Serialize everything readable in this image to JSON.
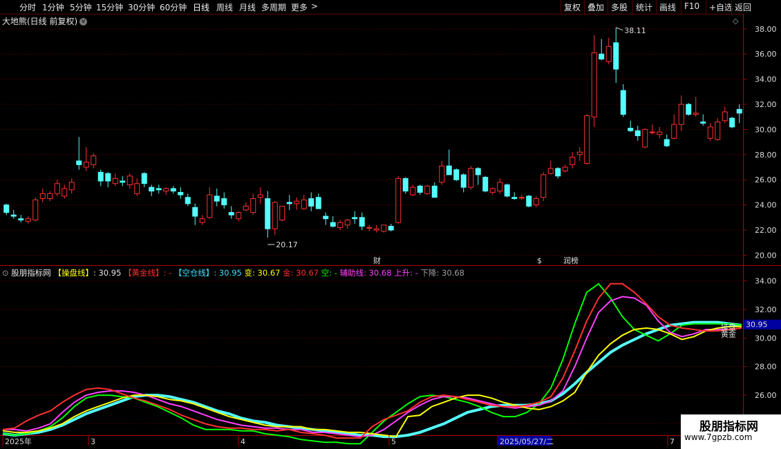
{
  "toolbar": {
    "periods": [
      "分时",
      "1分钟",
      "5分钟",
      "15分钟",
      "30分钟",
      "60分钟",
      "日线",
      "周线",
      "月线",
      "多周期",
      "更多"
    ],
    "active_period": "日线",
    "more_arrow": ">",
    "right_buttons": [
      "复权",
      "叠加",
      "多股",
      "统计",
      "画线",
      "F10",
      "+自选",
      "返回"
    ]
  },
  "main_chart": {
    "title": "大地熊(日线 前复权)",
    "chevron_glyph": "v",
    "diamond_glyph": "◇",
    "gear_glyph": "⚙"
  },
  "indicator": {
    "name": "股朋指标网",
    "segments": [
      {
        "text": "【操盘线】",
        "color": "#ffff00"
      },
      {
        "text": ": 30.95 ",
        "color": "#e6e6e6"
      },
      {
        "text": "【黄金线】",
        "color": "#ff3030"
      },
      {
        "text": ": - ",
        "color": "#ff3030"
      },
      {
        "text": "【空仓线】",
        "color": "#40e0ff"
      },
      {
        "text": ": 30.95 ",
        "color": "#40e0ff"
      },
      {
        "text": "变: 30.67 ",
        "color": "#ffff00"
      },
      {
        "text": "金: 30.67 ",
        "color": "#ff3030"
      },
      {
        "text": "空: - ",
        "color": "#00ff00"
      },
      {
        "text": "辅助线: 30.68 ",
        "color": "#ff40ff"
      },
      {
        "text": "上升: - ",
        "color": "#ff40ff"
      },
      {
        "text": "下降: 30.68",
        "color": "#a0a0a0"
      }
    ],
    "value_box": "30.95",
    "side_labels": [
      "操盘",
      "黄金"
    ]
  },
  "watermark": {
    "line1": "股朋指标网",
    "line2": "www.7gpzb.com"
  },
  "colors": {
    "up": "#ff3232",
    "down": "#54ffff",
    "grid": "#7a0000",
    "axis_border": "#b40000"
  },
  "chart_data": [
    {
      "type": "candlestick",
      "title": "大地熊(日线 前复权)",
      "ylim": [
        19.2,
        39.2
      ],
      "yticks": [
        20,
        22,
        24,
        26,
        28,
        30,
        32,
        34,
        36,
        38
      ],
      "ytick_labels": [
        "20.00",
        "22.00",
        "24.00",
        "26.00",
        "28.00",
        "30.00",
        "32.00",
        "34.00",
        "36.00",
        "38.00"
      ],
      "annotations": {
        "high": "38.11",
        "low": "20.17"
      },
      "markers": [
        "财",
        "$",
        "润榜"
      ],
      "ohlc": [
        [
          24.0,
          24.1,
          23.2,
          23.4
        ],
        [
          23.2,
          23.6,
          22.9,
          23.1
        ],
        [
          22.9,
          23.2,
          22.6,
          22.8
        ],
        [
          22.7,
          23.1,
          22.5,
          22.9
        ],
        [
          22.8,
          24.6,
          22.7,
          24.4
        ],
        [
          24.5,
          25.3,
          24.2,
          24.9
        ],
        [
          24.5,
          25.1,
          24.3,
          24.9
        ],
        [
          24.9,
          26.0,
          24.7,
          25.7
        ],
        [
          24.7,
          25.6,
          24.5,
          25.3
        ],
        [
          25.2,
          26.1,
          24.9,
          25.8
        ],
        [
          27.5,
          29.4,
          26.8,
          27.2
        ],
        [
          27.0,
          28.6,
          26.7,
          27.4
        ],
        [
          27.2,
          28.1,
          26.9,
          27.9
        ],
        [
          26.6,
          26.8,
          25.5,
          25.9
        ],
        [
          26.5,
          26.6,
          25.4,
          25.9
        ],
        [
          25.7,
          26.5,
          25.5,
          26.1
        ],
        [
          25.9,
          26.3,
          25.5,
          25.8
        ],
        [
          25.6,
          26.5,
          25.3,
          26.3
        ],
        [
          24.9,
          26.1,
          24.7,
          25.7
        ],
        [
          26.5,
          26.6,
          25.4,
          25.7
        ],
        [
          25.4,
          25.6,
          24.7,
          25.1
        ],
        [
          25.3,
          25.6,
          24.9,
          25.2
        ],
        [
          25.1,
          25.4,
          24.8,
          25.3
        ],
        [
          25.3,
          25.5,
          24.9,
          25.1
        ],
        [
          25.0,
          25.4,
          24.5,
          24.8
        ],
        [
          24.6,
          24.9,
          23.9,
          24.1
        ],
        [
          23.8,
          24.1,
          22.4,
          23.1
        ],
        [
          22.6,
          23.2,
          22.4,
          22.9
        ],
        [
          23.0,
          25.4,
          22.9,
          24.8
        ],
        [
          24.7,
          25.3,
          23.9,
          24.3
        ],
        [
          24.5,
          25.0,
          23.7,
          24.0
        ],
        [
          23.4,
          23.9,
          22.9,
          23.2
        ],
        [
          22.9,
          23.5,
          22.7,
          23.4
        ],
        [
          23.6,
          24.2,
          23.5,
          23.9
        ],
        [
          23.4,
          24.9,
          23.2,
          24.5
        ],
        [
          24.6,
          25.4,
          24.1,
          24.8
        ],
        [
          24.5,
          25.1,
          21.4,
          22.1
        ],
        [
          22.1,
          24.3,
          21.6,
          24.2
        ],
        [
          22.8,
          23.8,
          22.7,
          23.9
        ],
        [
          24.2,
          24.8,
          23.6,
          24.1
        ],
        [
          24.1,
          24.6,
          23.6,
          24.3
        ],
        [
          23.7,
          24.8,
          23.6,
          24.4
        ],
        [
          24.5,
          25.0,
          23.5,
          23.9
        ],
        [
          24.6,
          24.9,
          23.7,
          23.7
        ],
        [
          23.1,
          23.4,
          22.4,
          22.9
        ],
        [
          22.6,
          23.1,
          22.2,
          22.3
        ],
        [
          22.2,
          22.8,
          22.0,
          22.6
        ],
        [
          22.4,
          22.9,
          22.1,
          22.8
        ],
        [
          23.0,
          23.5,
          22.5,
          22.9
        ],
        [
          23.0,
          23.4,
          22.0,
          22.3
        ],
        [
          22.2,
          22.4,
          21.9,
          22.2
        ],
        [
          22.0,
          22.4,
          21.8,
          22.1
        ],
        [
          21.9,
          22.4,
          21.8,
          22.4
        ],
        [
          22.3,
          22.5,
          21.9,
          22.0
        ],
        [
          22.6,
          26.3,
          22.5,
          26.1
        ],
        [
          26.1,
          26.2,
          24.9,
          25.1
        ],
        [
          24.8,
          25.6,
          24.7,
          25.4
        ],
        [
          25.5,
          25.6,
          24.8,
          25.0
        ],
        [
          24.9,
          25.6,
          24.8,
          25.5
        ],
        [
          25.5,
          25.8,
          24.6,
          24.6
        ],
        [
          25.8,
          27.5,
          25.6,
          27.1
        ],
        [
          27.1,
          28.4,
          26.6,
          26.4
        ],
        [
          26.8,
          26.9,
          25.9,
          26.0
        ],
        [
          26.4,
          26.5,
          25.0,
          25.4
        ],
        [
          25.4,
          27.1,
          25.2,
          26.9
        ],
        [
          26.9,
          27.0,
          25.6,
          26.4
        ],
        [
          26.2,
          26.3,
          25.0,
          25.1
        ],
        [
          25.0,
          25.4,
          24.8,
          25.3
        ],
        [
          25.1,
          26.1,
          24.9,
          25.8
        ],
        [
          25.6,
          25.7,
          24.6,
          24.7
        ],
        [
          24.6,
          25.0,
          24.4,
          24.5
        ],
        [
          24.6,
          24.8,
          24.4,
          24.6
        ],
        [
          24.7,
          24.8,
          23.8,
          23.9
        ],
        [
          24.0,
          24.7,
          23.8,
          24.5
        ],
        [
          24.6,
          26.6,
          24.3,
          26.4
        ],
        [
          26.5,
          27.5,
          26.4,
          26.9
        ],
        [
          26.9,
          27.0,
          26.1,
          26.3
        ],
        [
          26.7,
          27.2,
          26.6,
          27.0
        ],
        [
          27.2,
          28.2,
          26.9,
          27.8
        ],
        [
          28.0,
          28.6,
          27.5,
          28.2
        ],
        [
          27.3,
          31.2,
          27.2,
          31.1
        ],
        [
          31.0,
          37.5,
          30.2,
          36.1
        ],
        [
          36.0,
          37.2,
          35.5,
          35.6
        ],
        [
          35.4,
          37.3,
          35.2,
          36.6
        ],
        [
          36.9,
          38.11,
          33.7,
          34.8
        ],
        [
          33.1,
          33.6,
          31.0,
          31.2
        ],
        [
          30.1,
          30.7,
          29.8,
          29.9
        ],
        [
          29.9,
          30.3,
          29.1,
          29.5
        ],
        [
          28.6,
          30.1,
          28.5,
          30.0
        ],
        [
          29.8,
          30.4,
          29.6,
          29.8
        ],
        [
          29.6,
          30.2,
          29.3,
          29.8
        ],
        [
          29.2,
          29.6,
          28.6,
          28.7
        ],
        [
          29.3,
          31.2,
          29.2,
          30.4
        ],
        [
          30.4,
          32.7,
          29.9,
          32.0
        ],
        [
          32.0,
          32.1,
          31.1,
          31.2
        ],
        [
          31.2,
          32.6,
          31.0,
          31.3
        ],
        [
          30.6,
          31.2,
          30.3,
          30.5
        ],
        [
          29.3,
          30.5,
          29.1,
          30.2
        ],
        [
          29.2,
          30.9,
          29.1,
          30.6
        ],
        [
          30.7,
          31.8,
          30.5,
          31.4
        ],
        [
          30.9,
          31.0,
          30.1,
          30.2
        ],
        [
          31.6,
          32.0,
          30.5,
          31.3
        ]
      ]
    },
    {
      "type": "line",
      "title": "股朋指标网",
      "ylim": [
        23.2,
        35.0
      ],
      "yticks": [
        24,
        26,
        28,
        30,
        32,
        34
      ],
      "ytick_labels": [
        "24.00",
        "26.00",
        "28.00",
        "30.00",
        "32.00",
        "34.00"
      ],
      "xtick_labels": [
        "2025年",
        "3",
        "4",
        "5",
        "2025/05/27/二",
        "7"
      ],
      "series": [
        {
          "name": "操盘线",
          "color": "#ffff00",
          "values": [
            23.5,
            23.4,
            23.4,
            23.5,
            23.7,
            24.0,
            24.5,
            24.9,
            25.2,
            25.5,
            25.8,
            26.0,
            26.0,
            25.9,
            25.7,
            25.6,
            25.4,
            25.1,
            24.8,
            24.5,
            24.3,
            24.1,
            23.9,
            23.8,
            23.8,
            23.8,
            23.6,
            23.6,
            23.5,
            23.4,
            23.4,
            23.3,
            23.2,
            23.1,
            24.5,
            24.6,
            25.2,
            25.5,
            25.8,
            26.0,
            26.0,
            25.8,
            25.5,
            25.3,
            25.1,
            25.0,
            25.2,
            25.6,
            26.2,
            27.6,
            28.8,
            29.6,
            30.2,
            30.6,
            30.7,
            30.6,
            30.3,
            29.9,
            30.1,
            30.5,
            30.7,
            30.8,
            30.8
          ]
        },
        {
          "name": "黄金线",
          "color": "#ff3030",
          "values": [
            23.6,
            23.7,
            24.2,
            24.6,
            24.9,
            25.5,
            26.0,
            26.4,
            26.5,
            26.4,
            26.1,
            25.8,
            25.6,
            25.3,
            25.0,
            24.6,
            24.3,
            24.0,
            23.8,
            23.7,
            23.7,
            23.6,
            23.6,
            23.5,
            23.6,
            23.4,
            23.3,
            23.2,
            23.0,
            23.0,
            23.0,
            23.8,
            24.3,
            24.6,
            24.9,
            25.5,
            25.9,
            26.0,
            25.9,
            25.7,
            25.5,
            25.3,
            25.2,
            25.2,
            25.3,
            25.5,
            25.9,
            27.2,
            29.1,
            31.2,
            32.8,
            33.8,
            33.8,
            33.2,
            32.4,
            31.5,
            30.9,
            30.7,
            30.6,
            30.5,
            30.5,
            30.6,
            30.7
          ]
        },
        {
          "name": "空仓线",
          "color": "#54ffff",
          "values": [
            23.3,
            23.2,
            23.3,
            23.4,
            23.6,
            23.9,
            24.3,
            24.7,
            25.0,
            25.3,
            25.6,
            25.9,
            26.0,
            26.0,
            25.9,
            25.7,
            25.5,
            25.2,
            24.9,
            24.7,
            24.4,
            24.2,
            24.1,
            23.9,
            23.8,
            23.7,
            23.6,
            23.5,
            23.4,
            23.3,
            23.2,
            23.2,
            23.1,
            23.1,
            23.2,
            23.4,
            23.7,
            24.0,
            24.4,
            24.8,
            25.0,
            25.2,
            25.3,
            25.3,
            25.3,
            25.4,
            25.6,
            26.1,
            26.8,
            27.6,
            28.3,
            29.0,
            29.5,
            29.9,
            30.3,
            30.6,
            30.9,
            31.0,
            31.1,
            31.1,
            31.1,
            31.0,
            30.9
          ]
        },
        {
          "name": "辅助线",
          "color": "#ff40ff",
          "values": [
            23.6,
            23.6,
            23.5,
            23.7,
            24.0,
            24.8,
            25.5,
            26.0,
            26.2,
            26.3,
            26.3,
            26.2,
            26.0,
            25.7,
            25.4,
            25.2,
            24.9,
            24.6,
            24.3,
            24.1,
            23.9,
            23.8,
            23.7,
            23.7,
            23.6,
            23.6,
            23.4,
            23.4,
            23.3,
            23.2,
            23.1,
            23.2,
            23.6,
            24.2,
            24.8,
            25.3,
            25.7,
            25.9,
            25.9,
            25.8,
            25.6,
            25.4,
            25.2,
            25.1,
            25.2,
            25.3,
            25.6,
            26.3,
            28.0,
            30.0,
            31.8,
            32.6,
            32.9,
            32.8,
            32.3,
            31.2,
            30.4,
            30.1,
            30.3,
            30.6,
            30.6,
            30.6,
            30.7
          ]
        },
        {
          "name": "空",
          "color": "#00ff00",
          "values": [
            23.3,
            23.2,
            23.3,
            23.5,
            23.8,
            24.4,
            25.2,
            25.8,
            26.0,
            26.0,
            25.9,
            25.8,
            25.5,
            25.2,
            24.8,
            24.4,
            23.9,
            23.6,
            23.6,
            23.6,
            23.5,
            23.5,
            23.3,
            23.2,
            23.1,
            22.9,
            22.8,
            22.7,
            22.7,
            22.6,
            22.6,
            23.4,
            24.2,
            24.8,
            25.4,
            25.9,
            26.0,
            25.9,
            25.7,
            25.5,
            25.2,
            24.8,
            24.5,
            24.5,
            24.8,
            25.4,
            26.5,
            28.5,
            31.0,
            33.2,
            33.8,
            32.8,
            31.5,
            30.6,
            30.2,
            29.8,
            30.3,
            30.9,
            31.0,
            31.0,
            31.0,
            31.0,
            30.9
          ]
        }
      ]
    }
  ]
}
